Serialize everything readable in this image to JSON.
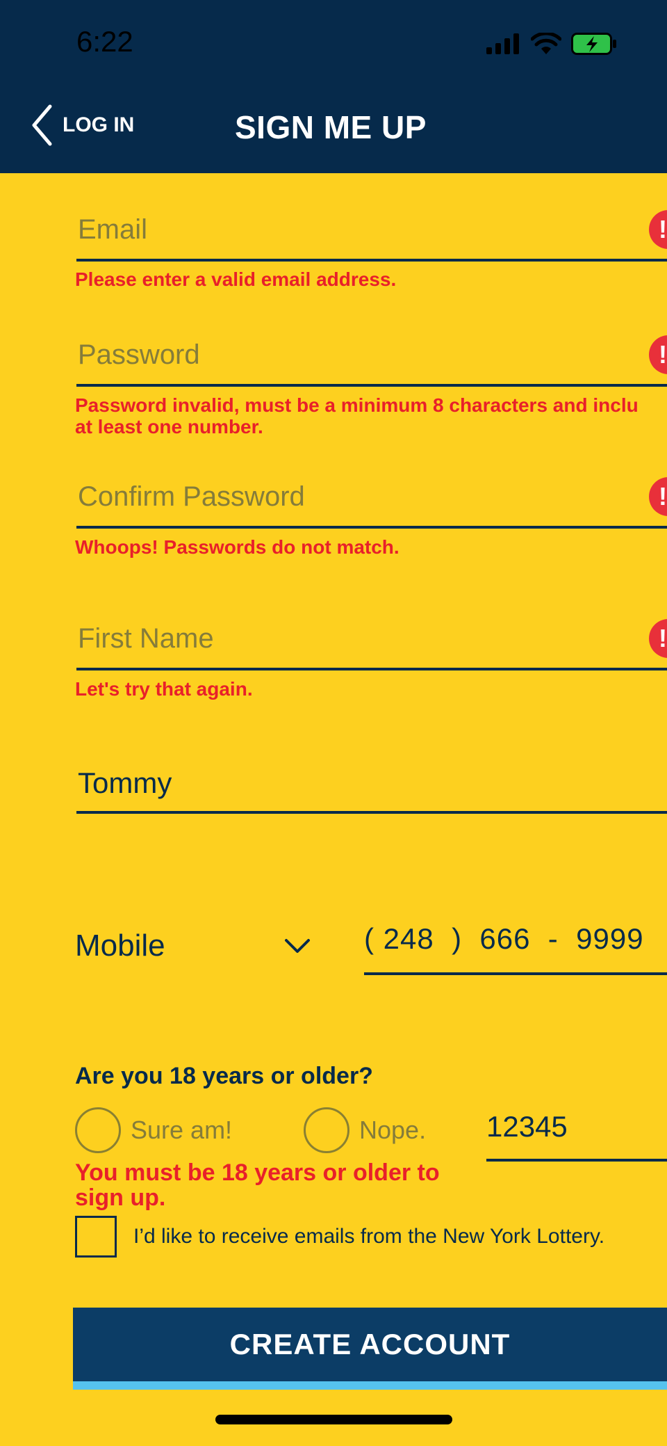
{
  "status_bar": {
    "time": "6:22",
    "icons": [
      "cellular-signal-icon",
      "wifi-icon",
      "battery-charging-icon"
    ]
  },
  "header": {
    "back_label": "LOG IN",
    "title": "SIGN ME UP"
  },
  "fields": {
    "email": {
      "placeholder": "Email",
      "error": "Please enter a valid email address."
    },
    "password": {
      "placeholder": "Password",
      "error_line1": "Password invalid, must be a minimum 8 characters and inclu",
      "error_line2": "at least one number."
    },
    "confirm_password": {
      "placeholder": "Confirm Password",
      "error": "Whoops! Passwords do not match."
    },
    "first_name": {
      "placeholder": "First Name",
      "error": "Let's try that again."
    },
    "last_name": {
      "value": "Tommy"
    }
  },
  "error_badge_glyph": "!",
  "phone": {
    "type_selected": "Mobile",
    "value": "( 248  )  666  -  9999"
  },
  "age": {
    "question": "Are you 18 years or older?",
    "yes_label": "Sure am!",
    "no_label": "Nope.",
    "error": "You must be 18 years or older to sign up."
  },
  "zip": {
    "value": "12345"
  },
  "optin": {
    "label": "I’d like to receive emails from the New York Lottery.",
    "checked": false
  },
  "create_button": {
    "label": "CREATE ACCOUNT"
  },
  "colors": {
    "background": "#FDD01F",
    "header": "#062A4B",
    "error": "#E8202A",
    "button": "#0C3D66",
    "button_accent": "#56C3EE"
  }
}
